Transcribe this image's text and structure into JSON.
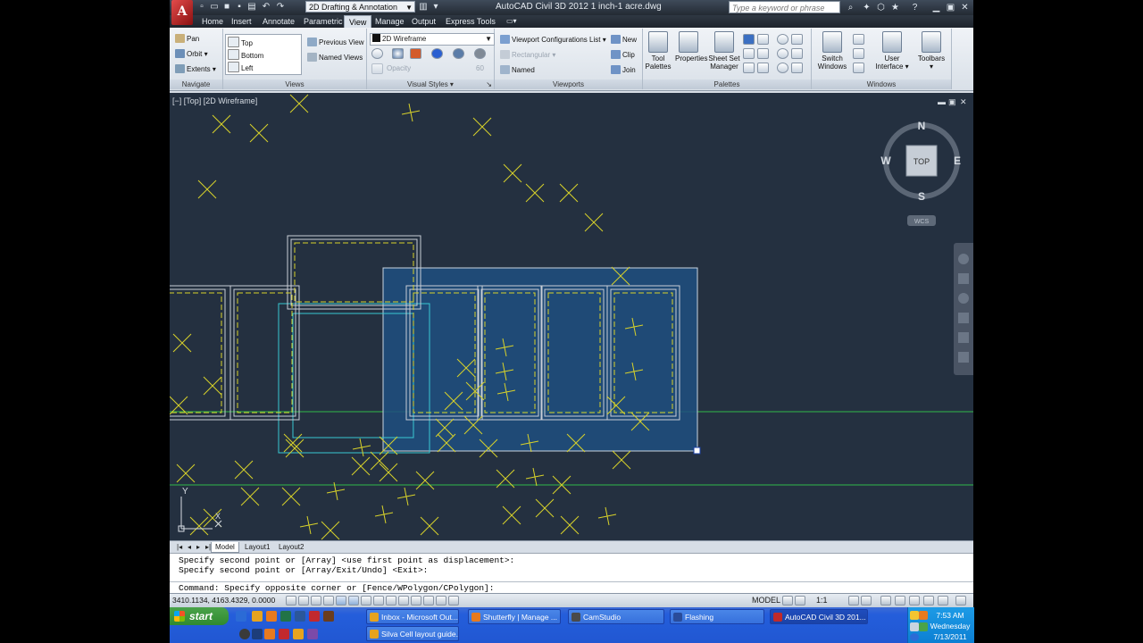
{
  "window": {
    "title": "AutoCAD Civil 3D 2012     1 inch-1 acre.dwg",
    "workspace": "2D Drafting & Annotation",
    "search_placeholder": "Type a keyword or phrase"
  },
  "ribbon_tabs": [
    "Home",
    "Insert",
    "Annotate",
    "Parametric",
    "View",
    "Manage",
    "Output",
    "Express Tools"
  ],
  "active_tab": "View",
  "panels": {
    "navigate": {
      "title": "Navigate",
      "items": [
        "Pan",
        "Orbit",
        "Extents"
      ]
    },
    "views": {
      "title": "Views",
      "list": [
        "Top",
        "Bottom",
        "Left"
      ],
      "previous": "Previous View",
      "named": "Named Views"
    },
    "visual_styles": {
      "title": "Visual Styles",
      "current": "2D Wireframe",
      "opacity_label": "Opacity",
      "opacity_value": "60"
    },
    "viewports": {
      "title": "Viewports",
      "config": "Viewport Configurations List",
      "rectangular": "Rectangular",
      "named": "Named",
      "new": "New",
      "clip": "Clip",
      "join": "Join"
    },
    "palettes": {
      "title": "Palettes",
      "tool": "Tool Palettes",
      "properties": "Properties",
      "sheet_set": "Sheet Set Manager"
    },
    "windows": {
      "title": "Windows",
      "switch": "Switch Windows",
      "user_interface": "User Interface",
      "toolbars": "Toolbars"
    }
  },
  "viewport": {
    "label": "[−] [Top] [2D Wireframe]",
    "compass": {
      "n": "N",
      "s": "S",
      "e": "E",
      "w": "W",
      "face": "TOP"
    },
    "ucs_badge": "WCS",
    "ucs_y": "Y",
    "ucs_x": "X"
  },
  "layout_tabs": [
    "Model",
    "Layout1",
    "Layout2"
  ],
  "command": {
    "history": [
      "Specify second point or [Array] <use first point as displacement>:",
      "Specify second point or [Array/Exit/Undo] <Exit>:"
    ],
    "current": "Command: Specify opposite corner or [Fence/WPolygon/CPolygon]:"
  },
  "status": {
    "coords": "3410.1134, 4163.4329, 0.0000",
    "model": "MODEL",
    "scale": "1:1"
  },
  "taskbar": {
    "start": "start",
    "tasks": [
      "Inbox - Microsoft Out...",
      "Shutterfly | Manage ...",
      "CamStudio",
      "Flashing",
      "AutoCAD Civil 3D 201..."
    ],
    "second_row": [
      "Silva Cell layout guide..."
    ],
    "clock": {
      "time": "7:53 AM",
      "day": "Wednesday",
      "date": "7/13/2011"
    }
  },
  "colors": {
    "drawing_bg": "#243040",
    "selection_fill": "#1f4f80",
    "accent_yellow": "#d8d22a",
    "green_line": "#2fb84a",
    "cyan": "#38c8d2"
  }
}
